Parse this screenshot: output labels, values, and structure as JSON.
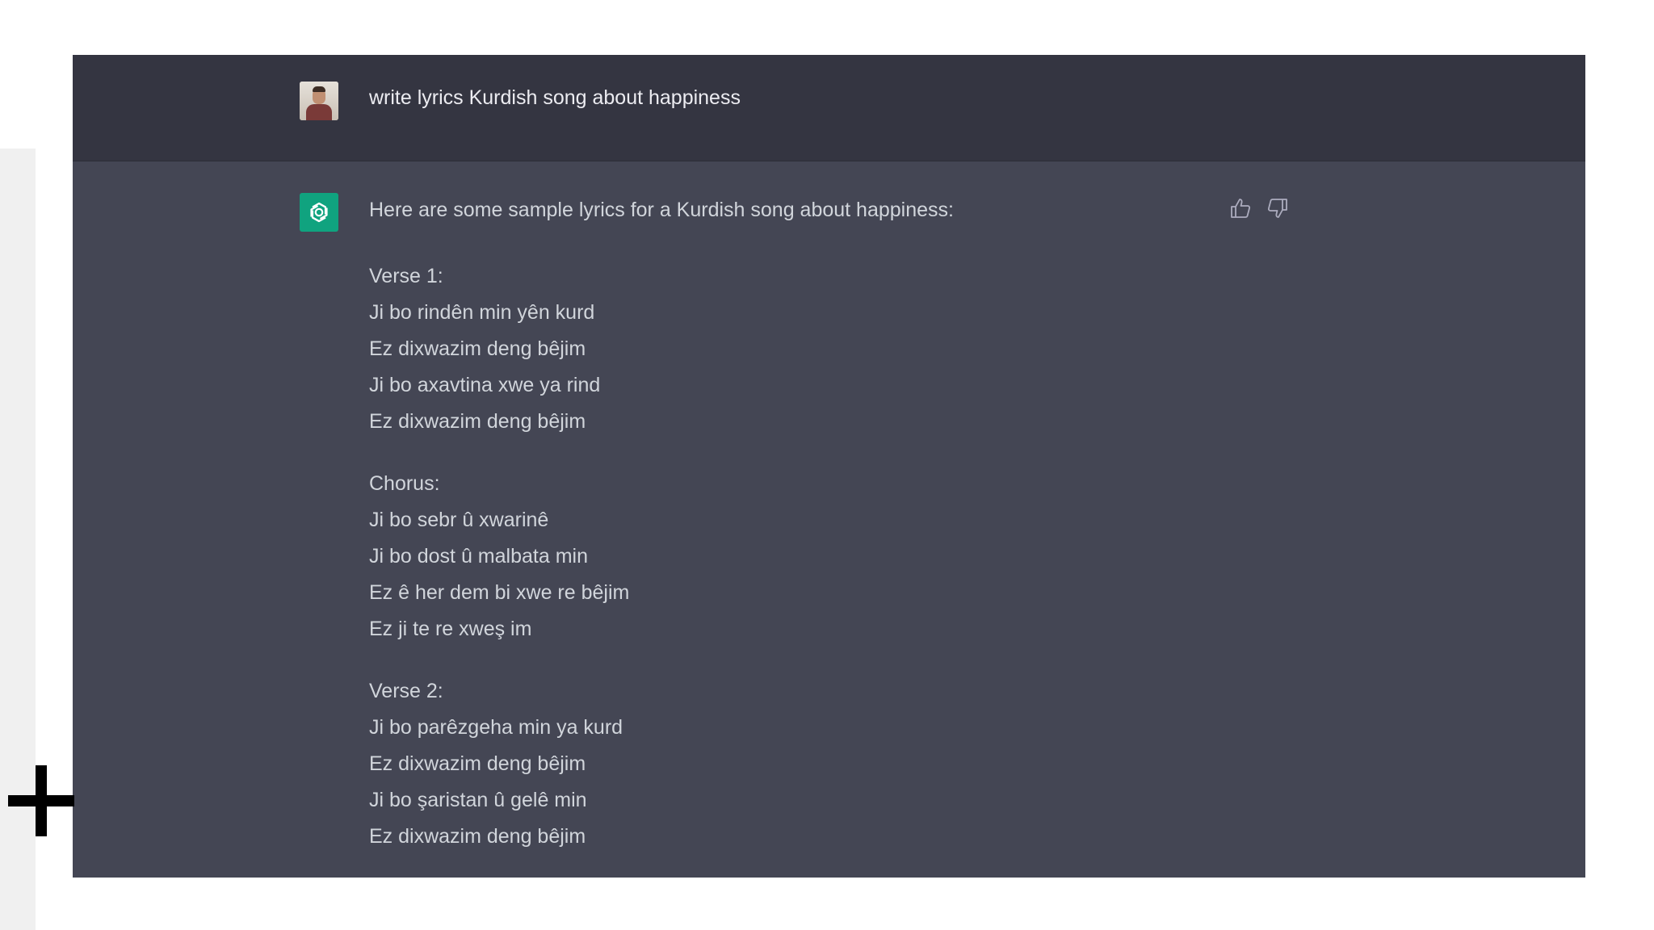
{
  "conversation": {
    "user_message": "write lyrics Kurdish song about happiness",
    "assistant_intro": "Here are some sample lyrics for a Kurdish song about happiness:",
    "stanzas": [
      {
        "label": "Verse 1:",
        "lines": [
          "Ji bo rindên min yên kurd",
          "Ez dixwazim deng bêjim",
          "Ji bo axavtina xwe ya rind",
          "Ez dixwazim deng bêjim"
        ]
      },
      {
        "label": "Chorus:",
        "lines": [
          "Ji bo sebr û xwarinê",
          "Ji bo dost û malbata min",
          "Ez ê her dem bi xwe re bêjim",
          "Ez ji te re xweş im"
        ]
      },
      {
        "label": "Verse 2:",
        "lines": [
          "Ji bo parêzgeha min ya kurd",
          "Ez dixwazim deng bêjim",
          "Ji bo şaristan û gelê min",
          "Ez dixwazim deng bêjim"
        ]
      }
    ]
  },
  "icons": {
    "user_avatar": "user-photo-avatar",
    "assistant_avatar": "openai-logo",
    "like": "thumbs-up-icon",
    "dislike": "thumbs-down-icon",
    "overlay": "plus-icon"
  },
  "colors": {
    "user_row_bg": "#343541",
    "assistant_row_bg": "#444654",
    "assistant_avatar_bg": "#10a37f",
    "text": "#d1d5db"
  }
}
